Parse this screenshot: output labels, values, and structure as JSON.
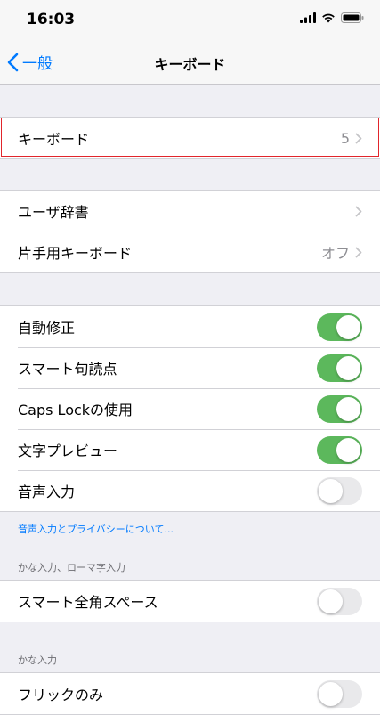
{
  "status_bar": {
    "time": "16:03",
    "icons": [
      "signal-icon",
      "wifi-icon",
      "battery-icon"
    ]
  },
  "nav": {
    "back_label": "一般",
    "title": "キーボード"
  },
  "keyboards_row": {
    "label": "キーボード",
    "value": "5"
  },
  "dictionary_group": [
    {
      "label": "ユーザ辞書",
      "value": ""
    },
    {
      "label": "片手用キーボード",
      "value": "オフ"
    }
  ],
  "toggles_group": [
    {
      "label": "自動修正",
      "on": true
    },
    {
      "label": "スマート句読点",
      "on": true
    },
    {
      "label": "Caps Lockの使用",
      "on": true
    },
    {
      "label": "文字プレビュー",
      "on": true
    },
    {
      "label": "音声入力",
      "on": false
    }
  ],
  "dictation_link": "音声入力とプライバシーについて...",
  "kana_romaji_section": {
    "header": "かな入力、ローマ字入力",
    "items": [
      {
        "label": "スマート全角スペース",
        "on": false
      }
    ]
  },
  "kana_section": {
    "header": "かな入力",
    "items": [
      {
        "label": "フリックのみ",
        "on": false
      }
    ]
  },
  "colors": {
    "accent": "#007aff",
    "toggle_on": "#5cb85c",
    "highlight": "#e1252b"
  }
}
